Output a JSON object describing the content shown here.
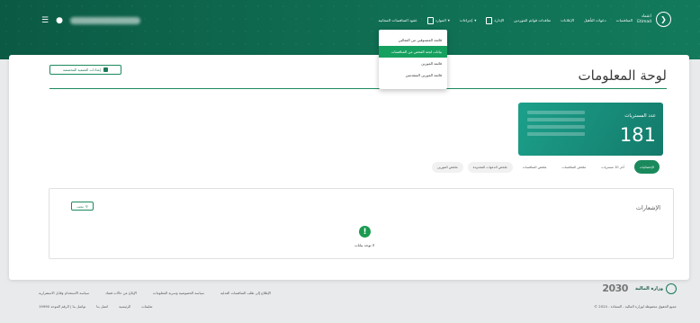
{
  "header": {
    "user_menu_icon": "dots-icon",
    "logo_text_line1": "اعتماد",
    "logo_text_line2": "Etimad",
    "nav": [
      {
        "label": "المنافسات"
      },
      {
        "label": "دعوات التأهيل"
      },
      {
        "label": "الإعلانات"
      },
      {
        "label": "تعاقدات قوائم الموردين"
      },
      {
        "label": "الإدارة"
      },
      {
        "label": "إجراءات"
      },
      {
        "label": "الموارد"
      },
      {
        "label": "عقود المنافسات المجانية"
      }
    ]
  },
  "dropdown": {
    "items": [
      {
        "label": "قائمة المتسوقين من الفعالين",
        "active": false
      },
      {
        "label": "بيانات لجنة الفحص من المنافسات",
        "active": true
      },
      {
        "label": "قائمة المورين",
        "active": false
      },
      {
        "label": "قائمة المورين المتقدمين",
        "active": false
      }
    ]
  },
  "main": {
    "publish_button": "إعدادات التصفية المخصصة",
    "page_title": "لوحة المعلومات",
    "stat_card": {
      "label": "عدد المستريات",
      "value": "181"
    },
    "tabs": [
      {
        "label": "الإحصائيات",
        "active": true
      },
      {
        "label": "آخر 10 مستريات",
        "active": false
      },
      {
        "label": "ملخص المنافسات",
        "active": false
      },
      {
        "label": "ملخص المنافسات",
        "active": false
      },
      {
        "label": "ملخص الدعوات المحدودة",
        "active": false
      },
      {
        "label": "ملخص المورين",
        "active": false
      }
    ],
    "notifications": {
      "title": "الإشعارات",
      "search_label": "بحث",
      "empty_message": "لا توجد بيانات"
    }
  },
  "footer": {
    "links_row1": [
      "الإطلاع إلى طلب المنافسات العدلية",
      "سياسة الخصوصية وسرية المعلومات",
      "الإبلاغ عن حالات فساد",
      "سياسة الاستخدام وقابل الاستقرارية"
    ],
    "links_row2": [
      "اتصل بنا",
      "تواصل بنا | الرقم الموحد 19990",
      "الرئيسية",
      "تعليمات"
    ],
    "copyright": "© جميع الحقوق محفوظة لوزارة المالية - السعادة - 2024",
    "ministry_name": "وزارة المالية",
    "vision_text": "2030"
  }
}
